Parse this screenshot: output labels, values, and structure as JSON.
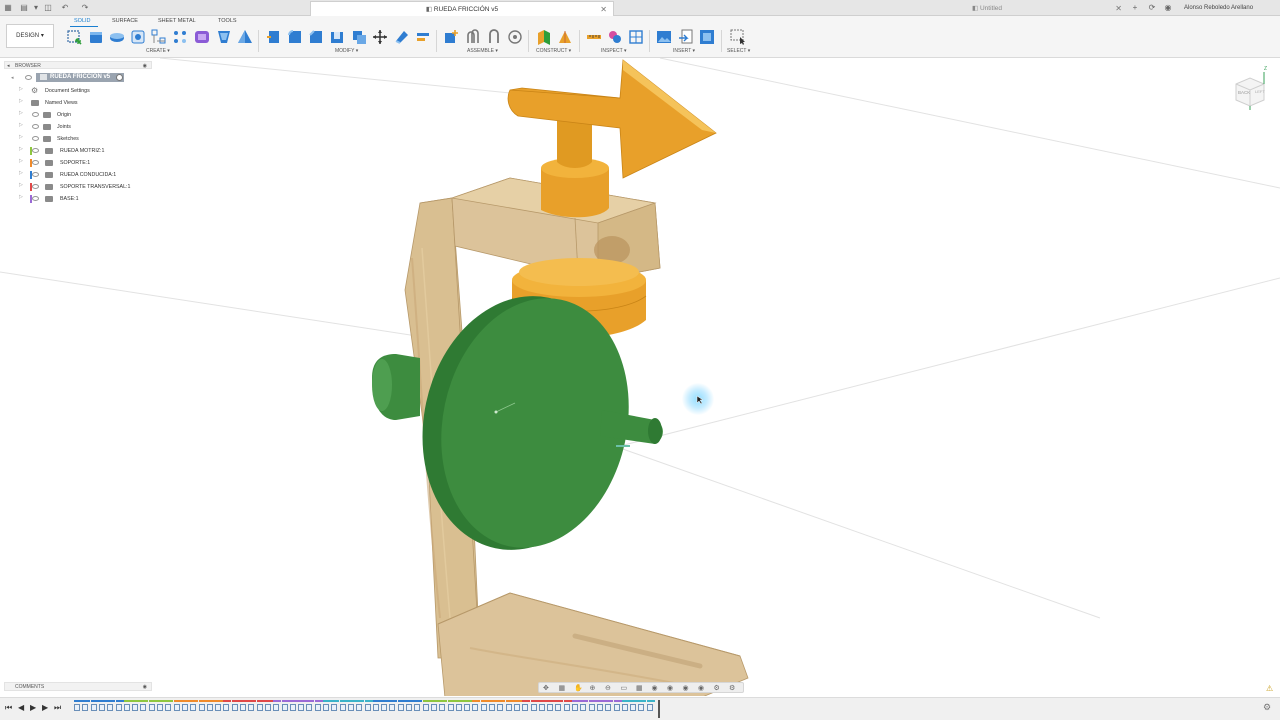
{
  "tabs": {
    "active_title": "RUEDA FRICCIÓN v5",
    "other_title": "Untitled",
    "user_name": "Alonso Reboledo Arellano"
  },
  "toolbar": {
    "design_label": "DESIGN",
    "workspace_tabs": [
      "SOLID",
      "SURFACE",
      "SHEET METAL",
      "TOOLS"
    ],
    "groups": {
      "create": "CREATE",
      "modify": "MODIFY",
      "assemble": "ASSEMBLE",
      "construct": "CONSTRUCT",
      "inspect": "INSPECT",
      "insert": "INSERT",
      "select": "SELECT"
    }
  },
  "browser": {
    "header": "BROWSER",
    "root": "RUEDA FRICCIÓN v5",
    "items": [
      {
        "label": "Document Settings"
      },
      {
        "label": "Named Views"
      },
      {
        "label": "Origin"
      },
      {
        "label": "Joints"
      },
      {
        "label": "Sketches"
      },
      {
        "label": "RUEDA MOTRIZ:1"
      },
      {
        "label": "SOPORTE:1"
      },
      {
        "label": "RUEDA CONDUCIDA:1"
      },
      {
        "label": "SOPORTE TRANSVERSAL:1"
      },
      {
        "label": "BASE:1"
      }
    ]
  },
  "viewcube": {
    "back": "BACK",
    "left": "LEFT",
    "z_axis": "Z"
  },
  "comments": {
    "label": "COMMENTS"
  },
  "colors": {
    "accent": "#1a7fd0",
    "wood": "#d9bf91",
    "green": "#3d8c3f",
    "orange": "#e8a02a"
  }
}
